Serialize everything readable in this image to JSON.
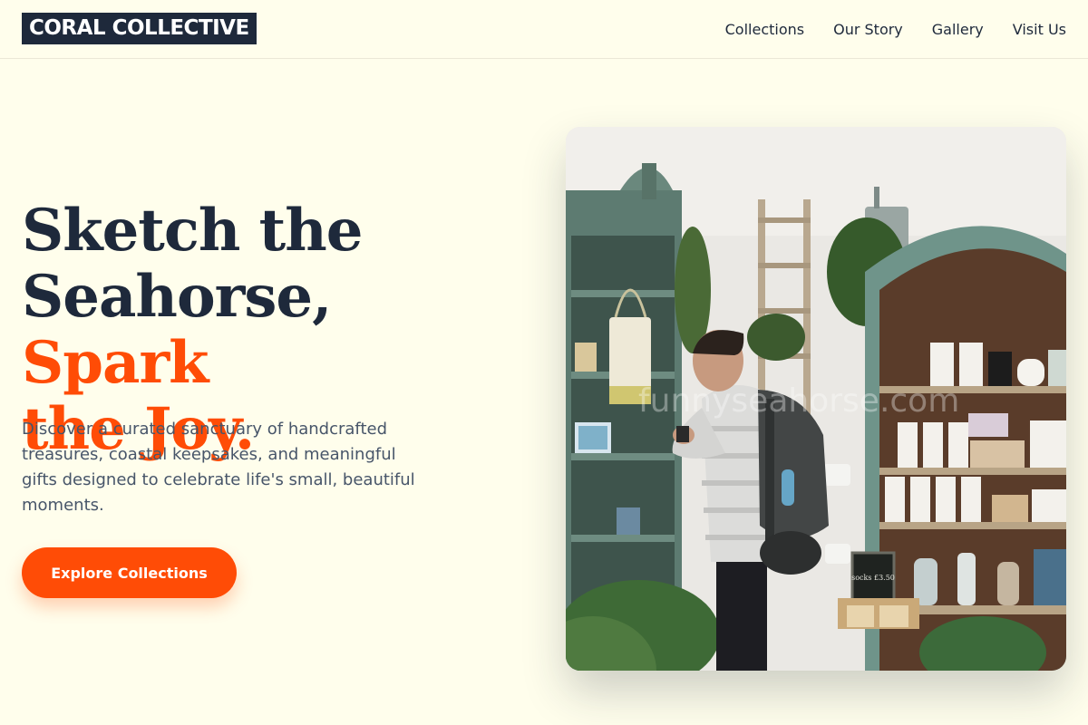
{
  "header": {
    "logo": "CORAL COLLECTIVE",
    "nav": [
      "Collections",
      "Our Story",
      "Gallery",
      "Visit Us"
    ]
  },
  "hero": {
    "title_line1": "Sketch the",
    "title_line2a": "Seahorse, ",
    "title_line2b": "Spark",
    "title_line3": "the Joy.",
    "description": "Discover a curated sanctuary of handcrafted treasures, coastal keepsakes, and meaningful gifts designed to celebrate life's small, beautiful moments.",
    "cta_label": "Explore Collections",
    "image_watermark": "funnyseahorse.com",
    "sign_text": "socks £3.50"
  },
  "colors": {
    "background": "#fffeec",
    "navy": "#1e293b",
    "accent": "#ff4c06",
    "body_text": "#475569"
  }
}
